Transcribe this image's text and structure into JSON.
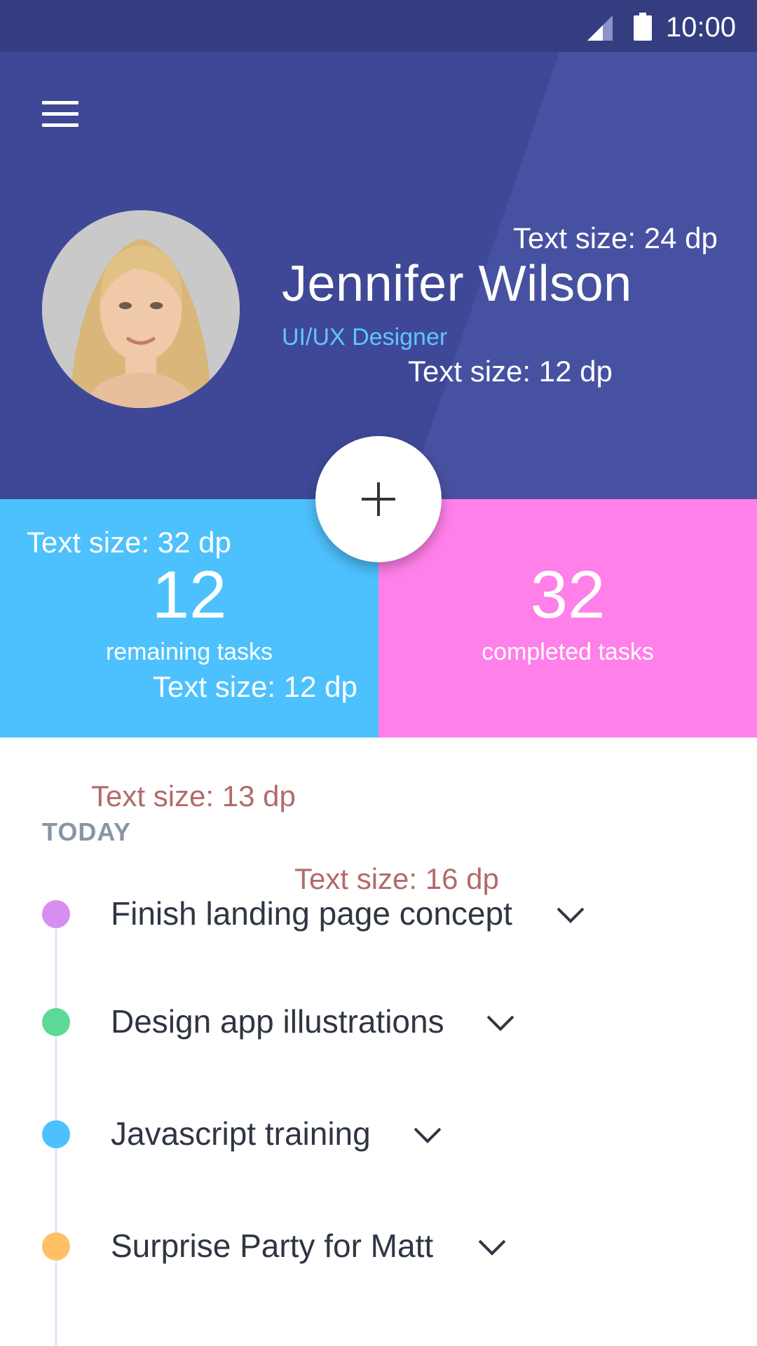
{
  "status_bar": {
    "time": "10:00",
    "signal_icon": "signal-icon",
    "battery_icon": "battery-icon"
  },
  "header": {
    "menu_icon": "hamburger-menu-icon",
    "name": "Jennifer Wilson",
    "role": "UI/UX Designer",
    "name_note": "Text size: 24 dp",
    "role_note": "Text size: 12 dp"
  },
  "fab": {
    "icon": "plus-icon"
  },
  "stats": {
    "remaining": {
      "value": "12",
      "label": "remaining tasks",
      "value_note": "Text size: 32 dp",
      "label_note": "Text size: 12 dp",
      "color": "#4dc1fd"
    },
    "completed": {
      "value": "32",
      "label": "completed tasks",
      "color": "#ff80e8"
    }
  },
  "tasks_section": {
    "title": "TODAY",
    "title_note": "Text size: 13 dp",
    "item_note": "Text size: 16 dp",
    "items": [
      {
        "title": "Finish landing page concept",
        "color": "#d78ef0"
      },
      {
        "title": "Design app illustrations",
        "color": "#5cd996"
      },
      {
        "title": "Javascript training",
        "color": "#4dc1fd"
      },
      {
        "title": "Surprise Party for Matt",
        "color": "#ffc163"
      }
    ]
  },
  "colors": {
    "status_bar": "#343d80",
    "header": "#3f4897",
    "accent_text": "#5ec6ff",
    "annotation": "#b36a6a"
  }
}
